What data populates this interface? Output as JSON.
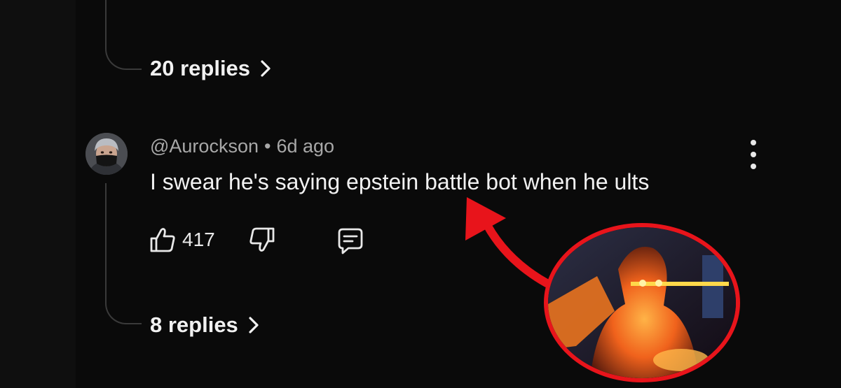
{
  "thread": {
    "top_replies_label": "20 replies",
    "bottom_replies_label": "8 replies"
  },
  "comment": {
    "author": "@Aurockson",
    "separator": "•",
    "timestamp": "6d ago",
    "text": "I swear he's saying epstein battle bot when he ults",
    "likes": "417"
  },
  "icons": {
    "avatar": "avatar-masked-person",
    "more": "more-vert-icon",
    "like": "thumbs-up-icon",
    "dislike": "thumbs-down-icon",
    "reply": "comment-icon",
    "chevron": "chevron-right-icon"
  },
  "colors": {
    "background": "#0a0a0a",
    "text": "#f1f1f1",
    "meta_text": "#a8a8a8",
    "thread_line": "#3a3a3a",
    "annotation_red": "#e8141b"
  }
}
